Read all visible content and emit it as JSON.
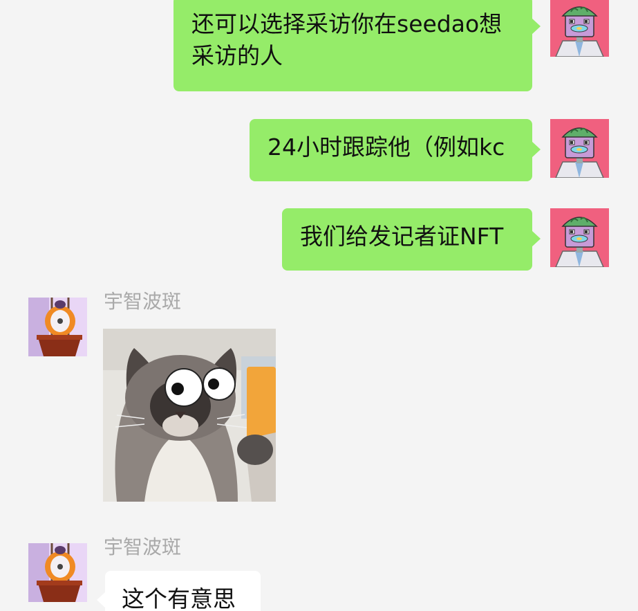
{
  "messages": [
    {
      "direction": "out",
      "text": "还可以选择采访你在seedao想采访的人"
    },
    {
      "direction": "out",
      "text": "24小时跟踪他（例如kc"
    },
    {
      "direction": "out",
      "text": "我们给发记者证NFT"
    },
    {
      "direction": "in",
      "sender": "宇智波斑",
      "type": "sticker",
      "sticker_icon": "googly-eyes-cat-sticker"
    },
    {
      "direction": "in",
      "sender": "宇智波斑",
      "text": "这个有意思"
    }
  ],
  "avatars": {
    "self": {
      "icon": "robot-nft-avatar",
      "bg_color": "#f0607f"
    },
    "other": {
      "icon": "flower-pot-avatar",
      "bg_color": "#e9d6f6"
    }
  },
  "colors": {
    "background": "#f4f4f4",
    "outgoing_bubble": "#95ec69",
    "incoming_bubble": "#ffffff",
    "sender_name": "#a9a9a9"
  }
}
